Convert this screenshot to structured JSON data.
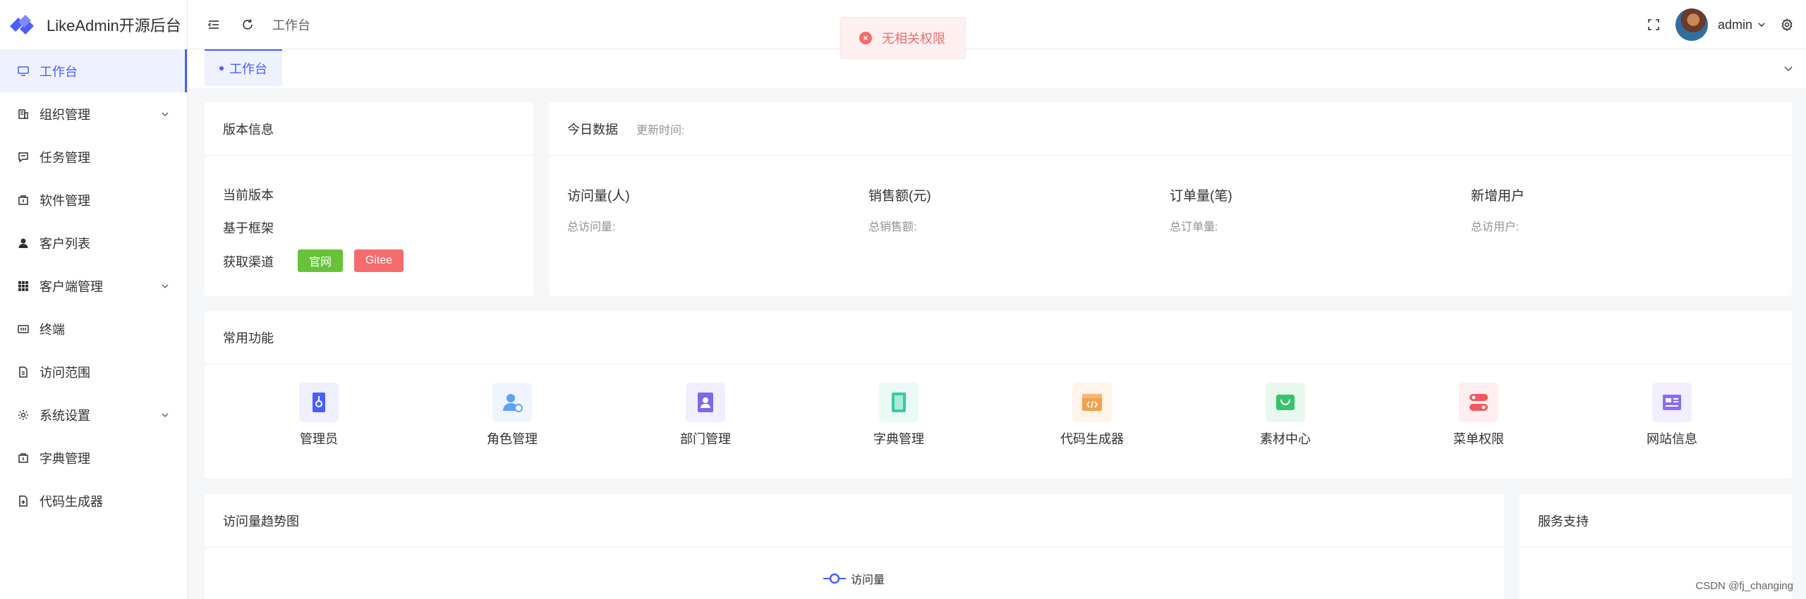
{
  "app": {
    "title": "LikeAdmin开源后台"
  },
  "sidebar": {
    "items": [
      {
        "label": "工作台",
        "icon": "monitor-icon",
        "active": true,
        "has_children": false
      },
      {
        "label": "组织管理",
        "icon": "building-icon",
        "active": false,
        "has_children": true
      },
      {
        "label": "任务管理",
        "icon": "message-icon",
        "active": false,
        "has_children": false
      },
      {
        "label": "软件管理",
        "icon": "package-icon",
        "active": false,
        "has_children": false
      },
      {
        "label": "客户列表",
        "icon": "user-icon",
        "active": false,
        "has_children": false
      },
      {
        "label": "客户端管理",
        "icon": "grid-icon",
        "active": false,
        "has_children": true
      },
      {
        "label": "终端",
        "icon": "terminal-icon",
        "active": false,
        "has_children": false
      },
      {
        "label": "访问范围",
        "icon": "document-icon",
        "active": false,
        "has_children": false
      },
      {
        "label": "系统设置",
        "icon": "gear-icon",
        "active": false,
        "has_children": true
      },
      {
        "label": "字典管理",
        "icon": "package-icon",
        "active": false,
        "has_children": false
      },
      {
        "label": "代码生成器",
        "icon": "document-add-icon",
        "active": false,
        "has_children": false
      }
    ]
  },
  "header": {
    "breadcrumb": "工作台",
    "username": "admin"
  },
  "toast": {
    "message": "无相关权限",
    "type": "error"
  },
  "tabs": [
    {
      "label": "工作台",
      "active": true
    }
  ],
  "version": {
    "title": "版本信息",
    "rows": [
      "当前版本",
      "基于框架",
      "获取渠道"
    ],
    "badges": [
      "官网",
      "Gitee"
    ]
  },
  "today": {
    "title": "今日数据",
    "update_label": "更新时间:",
    "stats": [
      {
        "title": "访问量(人)",
        "sub": "总访问量:"
      },
      {
        "title": "销售额(元)",
        "sub": "总销售额:"
      },
      {
        "title": "订单量(笔)",
        "sub": "总订单量:"
      },
      {
        "title": "新增用户",
        "sub": "总访用户:"
      }
    ]
  },
  "functions": {
    "title": "常用功能",
    "items": [
      {
        "label": "管理员",
        "icon": "admin-icon",
        "color": "#4a5dff",
        "bg": "#eef0ff"
      },
      {
        "label": "角色管理",
        "icon": "role-icon",
        "color": "#5aa3f5",
        "bg": "#eef5ff"
      },
      {
        "label": "部门管理",
        "icon": "department-icon",
        "color": "#7a6ae8",
        "bg": "#f1efff"
      },
      {
        "label": "字典管理",
        "icon": "dictionary-icon",
        "color": "#3cc8a3",
        "bg": "#eafaf5"
      },
      {
        "label": "代码生成器",
        "icon": "code-icon",
        "color": "#f5a04a",
        "bg": "#fff4ea"
      },
      {
        "label": "素材中心",
        "icon": "material-icon",
        "color": "#35c46a",
        "bg": "#e8f8ee"
      },
      {
        "label": "菜单权限",
        "icon": "menu-permission-icon",
        "color": "#f5565f",
        "bg": "#feeeef"
      },
      {
        "label": "网站信息",
        "icon": "website-icon",
        "color": "#8a6cf0",
        "bg": "#f2eeff"
      }
    ]
  },
  "trend": {
    "title": "访问量趋势图",
    "legend": "访问量"
  },
  "support": {
    "title": "服务支持"
  },
  "watermark": "CSDN @fj_changing"
}
